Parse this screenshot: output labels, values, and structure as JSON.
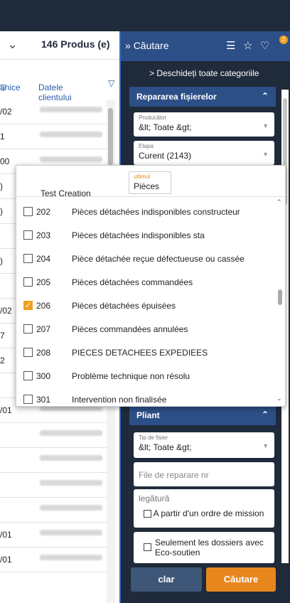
{
  "left": {
    "count_label": "146 Produs (e)",
    "col_headers": [
      "anice",
      "Datele clientului"
    ],
    "rows": [
      {
        "c1": "/02"
      },
      {
        "c1": "1"
      },
      {
        "c1": "00"
      },
      {
        "c1": ")"
      },
      {
        "c1": ")"
      },
      {
        "c1": ""
      },
      {
        "c1": ")"
      },
      {
        "c1": ""
      },
      {
        "c1": "/02"
      },
      {
        "c1": "7"
      },
      {
        "c1": "2"
      },
      {
        "c1": ""
      },
      {
        "c1": "/01"
      },
      {
        "c1": ""
      },
      {
        "c1": ""
      },
      {
        "c1": ""
      },
      {
        "c1": ""
      },
      {
        "c1": "/01"
      },
      {
        "c1": "/01"
      }
    ]
  },
  "right": {
    "title": "Căutare",
    "badge": "2",
    "open_all": "Deschideți toate categoriile",
    "section1": "Repararea fișierelor",
    "producer": {
      "label": "Producător",
      "value": "&lt; Toate &gt;"
    },
    "stage": {
      "label": "Etapa",
      "value": "Curent (2143)"
    },
    "section2": "Pliant",
    "file_type": {
      "label": "Tip de fișier",
      "value": "&lt; Toate &gt;"
    },
    "repair_no": {
      "placeholder": "File de reparare nr"
    },
    "link": {
      "label": "legătură",
      "check_label": "A partir d'un ordre de mission"
    },
    "eco": {
      "check_label": "Seulement les dossiers avec Eco-soutien"
    },
    "clear": "clar",
    "search": "Căutare"
  },
  "dropdown": {
    "header_text": "Test Creation",
    "input_label": "ultimul",
    "input_value": "Pièces",
    "items": [
      {
        "code": "202",
        "desc": "Pièces détachées indisponibles constructeur",
        "checked": false
      },
      {
        "code": "203",
        "desc": "Pièces détachées indisponibles sta",
        "checked": false
      },
      {
        "code": "204",
        "desc": "Pièce détachée reçue défectueuse ou cassée",
        "checked": false
      },
      {
        "code": "205",
        "desc": "Pièces détachées commandées",
        "checked": false
      },
      {
        "code": "206",
        "desc": "Pièces détachées épuisées",
        "checked": true
      },
      {
        "code": "207",
        "desc": "Pièces commandées annulées",
        "checked": false
      },
      {
        "code": "208",
        "desc": "PIECES DETACHEES EXPEDIEES",
        "checked": false
      },
      {
        "code": "300",
        "desc": "Problème technique non résolu",
        "checked": false
      },
      {
        "code": "301",
        "desc": "Intervention non finalisée",
        "checked": false
      }
    ]
  }
}
